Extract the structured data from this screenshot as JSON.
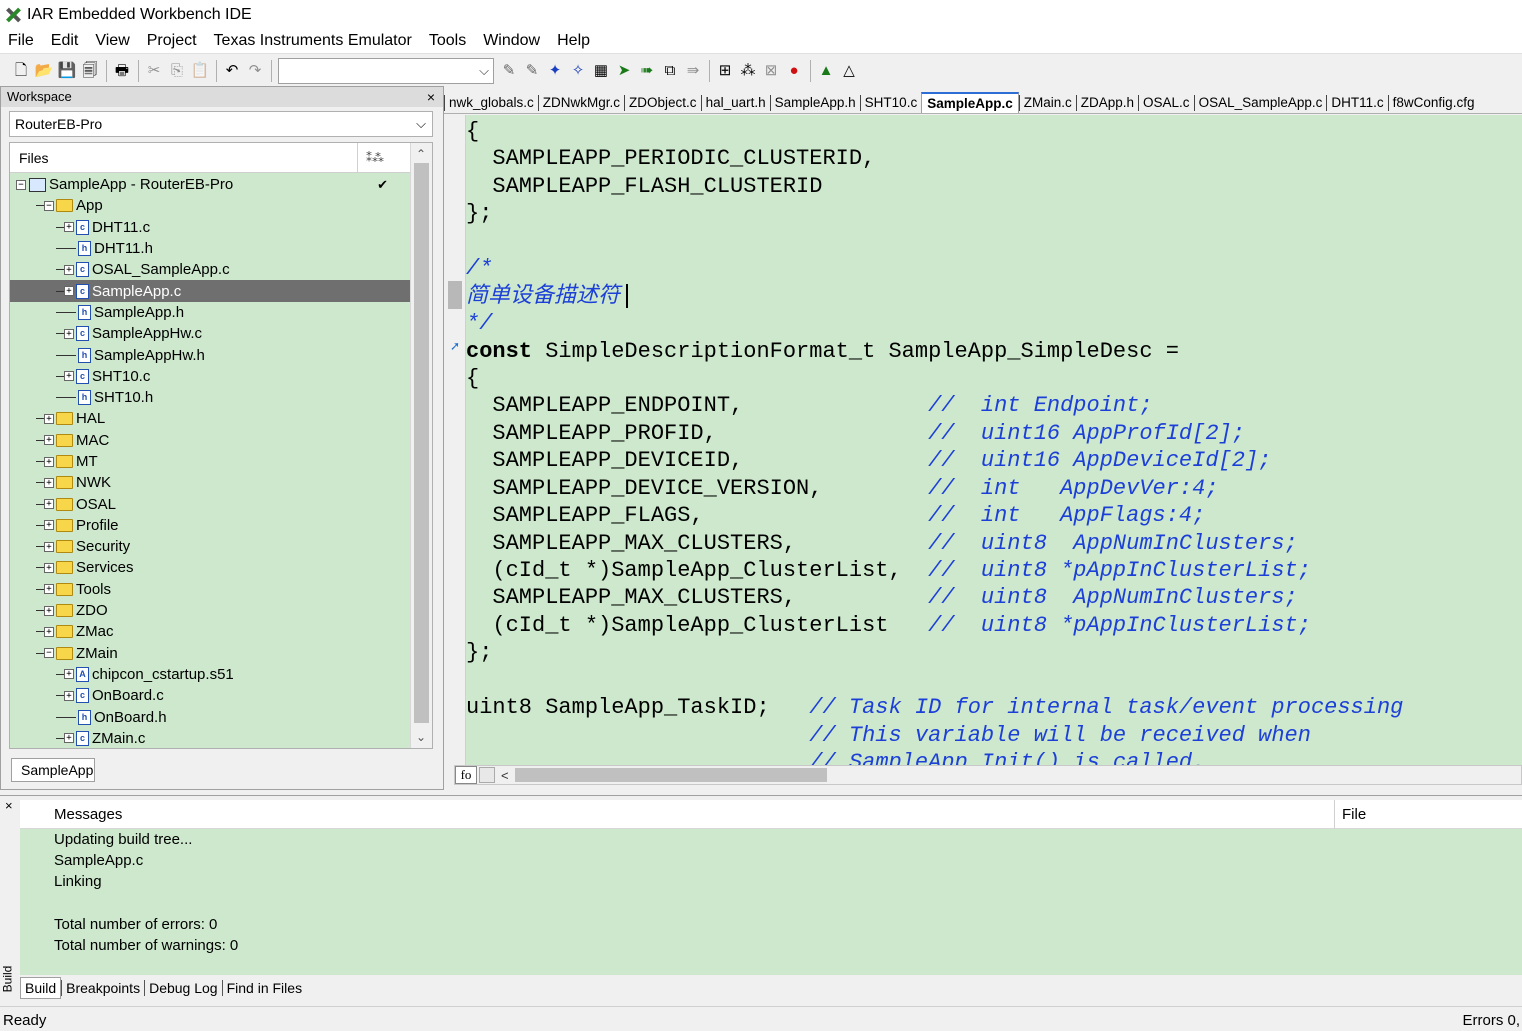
{
  "window": {
    "title": "IAR Embedded Workbench IDE"
  },
  "menu": [
    "File",
    "Edit",
    "View",
    "Project",
    "Texas Instruments Emulator",
    "Tools",
    "Window",
    "Help"
  ],
  "toolbar": {
    "combo_value": "",
    "icons": [
      "new-file-icon",
      "open-icon",
      "save-icon",
      "save-all-icon",
      "print-icon",
      "cut-icon",
      "copy-icon",
      "paste-icon",
      "undo-icon",
      "redo-icon",
      "toggle-bookmark-icon",
      "next-bookmark-icon",
      "find-icon",
      "replace-icon",
      "goto-icon",
      "navigate-back-icon",
      "navigate-forward-icon",
      "compile-icon",
      "make-icon",
      "stop-build-icon",
      "toggle-breakpoint-icon",
      "debug-icon",
      "debug-without-download-icon"
    ]
  },
  "workspace": {
    "header": "Workspace",
    "close": "×",
    "config": "RouterEB-Pro",
    "column_files": "Files",
    "bottom_tab": "SampleApp",
    "tree": [
      {
        "label": "SampleApp - RouterEB-Pro",
        "type": "project",
        "level": 0,
        "exp": "−",
        "check": "✔"
      },
      {
        "label": "App",
        "type": "folder",
        "level": 1,
        "exp": "−"
      },
      {
        "label": "DHT11.c",
        "type": "c",
        "level": 2,
        "exp": "+"
      },
      {
        "label": "DHT11.h",
        "type": "h",
        "level": 2,
        "exp": ""
      },
      {
        "label": "OSAL_SampleApp.c",
        "type": "c",
        "level": 2,
        "exp": "+"
      },
      {
        "label": "SampleApp.c",
        "type": "c",
        "level": 2,
        "exp": "+",
        "selected": true
      },
      {
        "label": "SampleApp.h",
        "type": "h",
        "level": 2,
        "exp": ""
      },
      {
        "label": "SampleAppHw.c",
        "type": "c",
        "level": 2,
        "exp": "+"
      },
      {
        "label": "SampleAppHw.h",
        "type": "h",
        "level": 2,
        "exp": ""
      },
      {
        "label": "SHT10.c",
        "type": "c",
        "level": 2,
        "exp": "+"
      },
      {
        "label": "SHT10.h",
        "type": "h",
        "level": 2,
        "exp": ""
      },
      {
        "label": "HAL",
        "type": "folder",
        "level": 1,
        "exp": "+"
      },
      {
        "label": "MAC",
        "type": "folder",
        "level": 1,
        "exp": "+"
      },
      {
        "label": "MT",
        "type": "folder",
        "level": 1,
        "exp": "+"
      },
      {
        "label": "NWK",
        "type": "folder",
        "level": 1,
        "exp": "+"
      },
      {
        "label": "OSAL",
        "type": "folder",
        "level": 1,
        "exp": "+"
      },
      {
        "label": "Profile",
        "type": "folder",
        "level": 1,
        "exp": "+"
      },
      {
        "label": "Security",
        "type": "folder",
        "level": 1,
        "exp": "+"
      },
      {
        "label": "Services",
        "type": "folder",
        "level": 1,
        "exp": "+"
      },
      {
        "label": "Tools",
        "type": "folder",
        "level": 1,
        "exp": "+"
      },
      {
        "label": "ZDO",
        "type": "folder",
        "level": 1,
        "exp": "+"
      },
      {
        "label": "ZMac",
        "type": "folder",
        "level": 1,
        "exp": "+"
      },
      {
        "label": "ZMain",
        "type": "folder",
        "level": 1,
        "exp": "−"
      },
      {
        "label": "chipcon_cstartup.s51",
        "type": "asm",
        "level": 2,
        "exp": "+"
      },
      {
        "label": "OnBoard.c",
        "type": "c",
        "level": 2,
        "exp": "+"
      },
      {
        "label": "OnBoard.h",
        "type": "h",
        "level": 2,
        "exp": ""
      },
      {
        "label": "ZMain.c",
        "type": "c",
        "level": 2,
        "exp": "+"
      }
    ]
  },
  "editor": {
    "tabs": [
      "nwk_globals.c",
      "ZDNwkMgr.c",
      "ZDObject.c",
      "hal_uart.h",
      "SampleApp.h",
      "SHT10.c",
      "SampleApp.c",
      "ZMain.c",
      "ZDApp.h",
      "OSAL.c",
      "OSAL_SampleApp.c",
      "DHT11.c",
      "f8wConfig.cfg"
    ],
    "active_tab": "SampleApp.c",
    "fo_button": "fo",
    "lines": [
      [
        {
          "t": "{",
          "s": ""
        }
      ],
      [
        {
          "t": "  SAMPLEAPP_PERIODIC_CLUSTERID,",
          "s": ""
        }
      ],
      [
        {
          "t": "  SAMPLEAPP_FLASH_CLUSTERID",
          "s": ""
        }
      ],
      [
        {
          "t": "};",
          "s": ""
        }
      ],
      [
        {
          "t": "",
          "s": ""
        }
      ],
      [
        {
          "t": "/*",
          "s": "cm"
        }
      ],
      [
        {
          "t": "简单设备描述符",
          "s": "cm"
        }
      ],
      [
        {
          "t": "*/",
          "s": "cm"
        }
      ],
      [
        {
          "t": "const",
          "s": "kw"
        },
        {
          "t": " SimpleDescriptionFormat_t SampleApp_SimpleDesc =",
          "s": ""
        }
      ],
      [
        {
          "t": "{",
          "s": ""
        }
      ],
      [
        {
          "t": "  SAMPLEAPP_ENDPOINT,              ",
          "s": ""
        },
        {
          "t": "//  int Endpoint;",
          "s": "cm"
        }
      ],
      [
        {
          "t": "  SAMPLEAPP_PROFID,                ",
          "s": ""
        },
        {
          "t": "//  uint16 AppProfId[2];",
          "s": "cm"
        }
      ],
      [
        {
          "t": "  SAMPLEAPP_DEVICEID,              ",
          "s": ""
        },
        {
          "t": "//  uint16 AppDeviceId[2];",
          "s": "cm"
        }
      ],
      [
        {
          "t": "  SAMPLEAPP_DEVICE_VERSION,        ",
          "s": ""
        },
        {
          "t": "//  int   AppDevVer:4;",
          "s": "cm"
        }
      ],
      [
        {
          "t": "  SAMPLEAPP_FLAGS,                 ",
          "s": ""
        },
        {
          "t": "//  int   AppFlags:4;",
          "s": "cm"
        }
      ],
      [
        {
          "t": "  SAMPLEAPP_MAX_CLUSTERS,          ",
          "s": ""
        },
        {
          "t": "//  uint8  AppNumInClusters;",
          "s": "cm"
        }
      ],
      [
        {
          "t": "  (cId_t *)SampleApp_ClusterList,  ",
          "s": ""
        },
        {
          "t": "//  uint8 *pAppInClusterList;",
          "s": "cm"
        }
      ],
      [
        {
          "t": "  SAMPLEAPP_MAX_CLUSTERS,          ",
          "s": ""
        },
        {
          "t": "//  uint8  AppNumInClusters;",
          "s": "cm"
        }
      ],
      [
        {
          "t": "  (cId_t *)SampleApp_ClusterList   ",
          "s": ""
        },
        {
          "t": "//  uint8 *pAppInClusterList;",
          "s": "cm"
        }
      ],
      [
        {
          "t": "};",
          "s": ""
        }
      ],
      [
        {
          "t": "",
          "s": ""
        }
      ],
      [
        {
          "t": "uint8 SampleApp_TaskID;   ",
          "s": ""
        },
        {
          "t": "// Task ID for internal task/event processing",
          "s": "cm"
        }
      ],
      [
        {
          "t": "                          ",
          "s": ""
        },
        {
          "t": "// This variable will be received when",
          "s": "cm"
        }
      ],
      [
        {
          "t": "                          ",
          "s": ""
        },
        {
          "t": "// SampleApp_Init() is called.",
          "s": "cm"
        }
      ]
    ]
  },
  "messages": {
    "close": "×",
    "side_label": "Build",
    "col_messages": "Messages",
    "col_file": "File",
    "lines": [
      "Updating build tree...",
      "SampleApp.c",
      "Linking",
      "",
      "Total number of errors: 0",
      "Total number of warnings: 0"
    ],
    "tabs": [
      "Build",
      "Breakpoints",
      "Debug Log",
      "Find in Files"
    ],
    "active_tab": "Build"
  },
  "status": {
    "left": "Ready",
    "right": "Errors 0,"
  }
}
